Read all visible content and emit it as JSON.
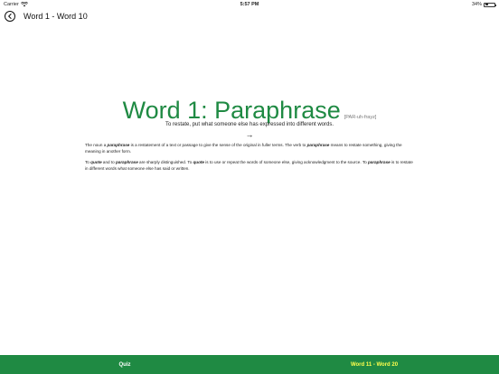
{
  "status": {
    "carrier": "Carrier",
    "time": "5:57 PM",
    "battery": "34%",
    "battery_level": 0.34
  },
  "nav": {
    "title": "Word 1 - Word 10"
  },
  "word": {
    "title": "Word 1: Paraphrase",
    "pronunciation": "[PAR-uh-frayz]",
    "definition": "To restate, put what someone else has expressed into different words.",
    "next_arrow": "→"
  },
  "body": {
    "p1": {
      "t1": "The noun a ",
      "b1": "paraphrase",
      "t2": " is a restatement of a text or passage to give the sense of the original in fuller terms. The verb to ",
      "b2": "paraphrase",
      "t3": " means to restate something, giving the meaning in another form."
    },
    "p2": {
      "t1": "To ",
      "b1": "quote",
      "t2": " and to ",
      "b2": "paraphrase",
      "t3": " are sharply distinguished. To ",
      "b3": "quote",
      "t4": " is to use or repeat the words of someone else, giving acknowledgment to the source. To ",
      "b4": "paraphrase",
      "t5": " is to restate in different words what someone else has said or written."
    }
  },
  "bottom": {
    "quiz_label": "Quiz",
    "next_label": "Word 11 - Word 20"
  },
  "colors": {
    "accent": "#1f8a43",
    "next_label": "#ffff4d"
  },
  "icons": {
    "back": "chevron-left-circle-icon",
    "wifi": "wifi-icon",
    "battery": "battery-icon"
  }
}
